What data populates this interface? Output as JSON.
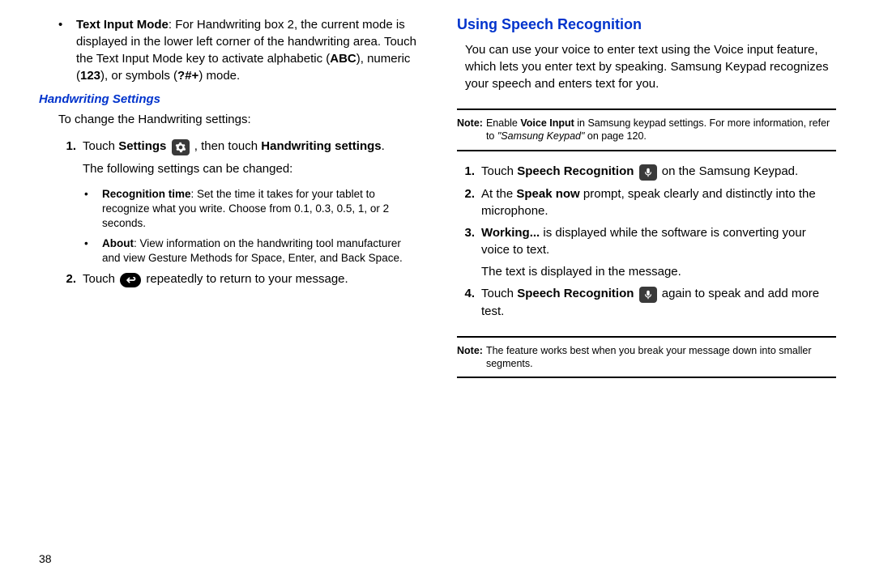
{
  "page_number": "38",
  "left": {
    "bullet1": {
      "lead": "Text Input Mode",
      "rest_a": ": For Handwriting box 2, the current mode is displayed in the lower left corner of the handwriting area. Touch the Text Input Mode key to activate alphabetic (",
      "b1": "ABC",
      "mid1": "), numeric (",
      "b2": "123",
      "mid2": "), or symbols (",
      "b3": "?#+",
      "tail": ") mode."
    },
    "sub_heading": "Handwriting Settings",
    "intro": "To change the Handwriting settings:",
    "step1": {
      "num": "1.",
      "a": "Touch ",
      "b1": "Settings",
      "mid": " , then touch ",
      "b2": "Handwriting settings",
      "tail": "."
    },
    "step1_sub": "The following settings can be changed:",
    "sub_bullet1": {
      "lead": "Recognition time",
      "rest": ": Set the time it takes for your tablet to recognize what you write. Choose from 0.1, 0.3, 0.5, 1, or 2 seconds."
    },
    "sub_bullet2": {
      "lead": "About",
      "rest": ": View information on the handwriting tool manufacturer and view Gesture Methods for Space, Enter, and Back Space."
    },
    "step2": {
      "num": "2.",
      "a": "Touch ",
      "tail": " repeatedly to return to your message."
    }
  },
  "right": {
    "heading": "Using Speech Recognition",
    "intro": "You can use your voice to enter text using the Voice input feature, which lets you enter text by speaking. Samsung Keypad recognizes your speech and enters text for you.",
    "note1": {
      "label": "Note:",
      "a": "Enable ",
      "b": "Voice Input",
      "c": " in Samsung keypad settings. For more information, refer to ",
      "ref": "\"Samsung Keypad\"",
      "d": "  on page 120."
    },
    "step1": {
      "num": "1.",
      "a": "Touch ",
      "b": "Speech Recognition",
      "c": "  on the Samsung Keypad."
    },
    "step2": {
      "num": "2.",
      "a": "At the ",
      "b": "Speak now",
      "c": " prompt, speak clearly and distinctly into the microphone."
    },
    "step3": {
      "num": "3.",
      "b": "Working...",
      "c": " is displayed while the software is converting your voice to text."
    },
    "step3_sub": "The text is displayed in the message.",
    "step4": {
      "num": "4.",
      "a": "Touch ",
      "b": "Speech Recognition",
      "c": "  again to speak and add more test."
    },
    "note2": {
      "label": "Note:",
      "text": "The feature works best when you break your message down into smaller segments."
    }
  }
}
